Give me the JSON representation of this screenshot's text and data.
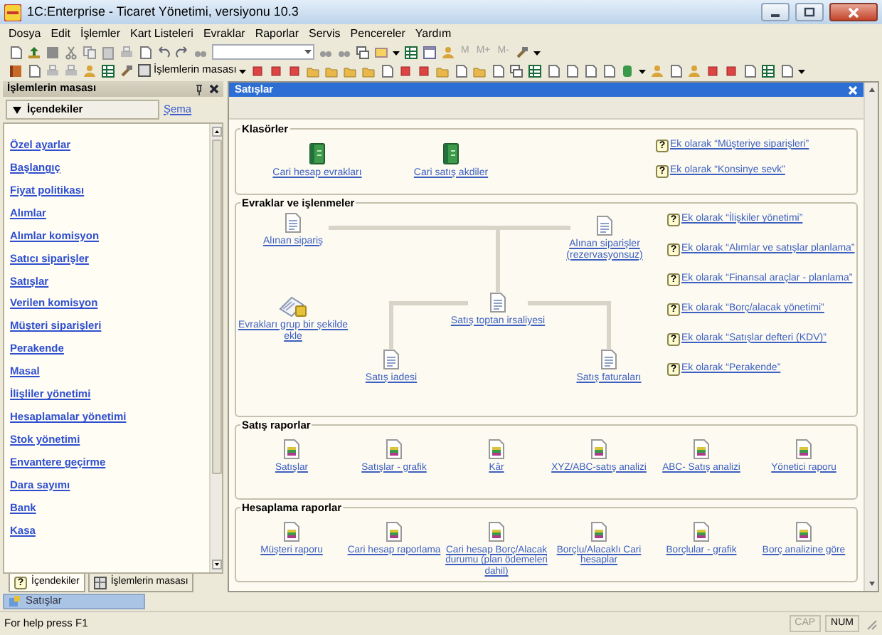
{
  "window": {
    "title": "1C:Enterprise - Ticaret Yönetimi, versiyonu 10.3"
  },
  "menu": [
    "Dosya",
    "Edit",
    "İşlemler",
    "Kart Listeleri",
    "Evraklar",
    "Raporlar",
    "Servis",
    "Pencereler",
    "Yardım"
  ],
  "toolbar": {
    "memory_buttons": [
      {
        "label": "M",
        "disabled": true
      },
      {
        "label": "M+",
        "disabled": true
      },
      {
        "label": "M-",
        "disabled": true
      }
    ],
    "panel_button": "İşlemlerin masası"
  },
  "left_panel": {
    "title": "İşlemlerin masası",
    "section_button": "İçendekiler",
    "schema_link": "Şema",
    "items": [
      "Özel ayarlar",
      "Başlangıç",
      "Fiyat politikası",
      "Alımlar",
      "Alımlar komisyon",
      "Satıcı siparişler",
      "Satışlar",
      "Verilen komisyon",
      "Müşteri siparişleri",
      "Perakende",
      "Masal",
      "İlişliler yönetimi",
      "Hesaplamalar yönetimi",
      "Stok yönetimi",
      "Envantere geçirme",
      "Dara sayımı",
      "Bank",
      "Kasa"
    ],
    "tabs": [
      {
        "label": "İçendekiler",
        "mark": "?",
        "selected": true
      },
      {
        "label": "İşlemlerin masası",
        "selected": false
      }
    ]
  },
  "main": {
    "title": "Satışlar",
    "groups": [
      {
        "title": "Klasörler",
        "kind": "row",
        "items": [
          {
            "label": "Cari hesap evrakları",
            "kind": "book"
          },
          {
            "label": "Cari satış akdiler",
            "kind": "book"
          }
        ],
        "help": [
          {
            "mark": "?",
            "label": "Ek olarak “Müşteriye siparişleri”"
          },
          {
            "mark": "?",
            "label": "Ek olarak “Konsinye sevk”"
          }
        ]
      },
      {
        "title": "Evraklar ve işlenmeler",
        "kind": "diagram",
        "items": [
          {
            "label": "Alınan sipariş",
            "kind": "document"
          },
          {
            "label": "Alınan siparişler (rezervasyonsuz)",
            "kind": "document"
          },
          {
            "label": "Evrakları grup bir şekilde ekle",
            "kind": "batch"
          },
          {
            "label": "Satış toptan irsaliyesi",
            "kind": "document"
          },
          {
            "label": "Satış iadesi",
            "kind": "document"
          },
          {
            "label": "Satış faturaları",
            "kind": "document"
          }
        ],
        "help": [
          {
            "mark": "?",
            "label": "Ek olarak “İlişkiler yönetimi”"
          },
          {
            "mark": "?",
            "label": "Ek olarak “Alımlar ve satışlar planlama”"
          },
          {
            "mark": "?",
            "label": "Ek olarak “Finansal araçlar - planlama”"
          },
          {
            "mark": "?",
            "label": "Ek olarak “Borç/alacak yönetimi”"
          },
          {
            "mark": "?",
            "label": "Ek olarak “Satışlar defteri (KDV)”"
          },
          {
            "mark": "?",
            "label": "Ek olarak “Perakende”"
          }
        ]
      },
      {
        "title": "Satış raporlar",
        "kind": "wide",
        "items": [
          {
            "label": "Satışlar",
            "kind": "report"
          },
          {
            "label": "Satışlar - grafik",
            "kind": "report"
          },
          {
            "label": "Kâr",
            "kind": "report"
          },
          {
            "label": "XYZ/ABC-satış analizi",
            "kind": "report"
          },
          {
            "label": "ABC- Satış analizi",
            "kind": "report"
          },
          {
            "label": "Yönetici raporu",
            "kind": "report"
          }
        ]
      },
      {
        "title": "Hesaplama raporlar",
        "kind": "wide",
        "items": [
          {
            "label": "Müşteri raporu",
            "kind": "report"
          },
          {
            "label": "Cari hesap raporlama",
            "kind": "report"
          },
          {
            "label": "Cari hesap Borç/Alacak durumu (plan ödemeleri dahil)",
            "kind": "report"
          },
          {
            "label": "Borçlu/Alacaklı Cari hesaplar",
            "kind": "report"
          },
          {
            "label": "Borçlular - grafik",
            "kind": "report"
          },
          {
            "label": "Borç analizine göre",
            "kind": "report"
          }
        ]
      }
    ]
  },
  "taskbar": [
    {
      "label": "Satışlar",
      "selected": true
    }
  ],
  "status_bar": {
    "text": "For help press F1",
    "indicators": [
      {
        "label": "CAP",
        "on": false
      },
      {
        "label": "NUM",
        "on": true
      }
    ]
  }
}
